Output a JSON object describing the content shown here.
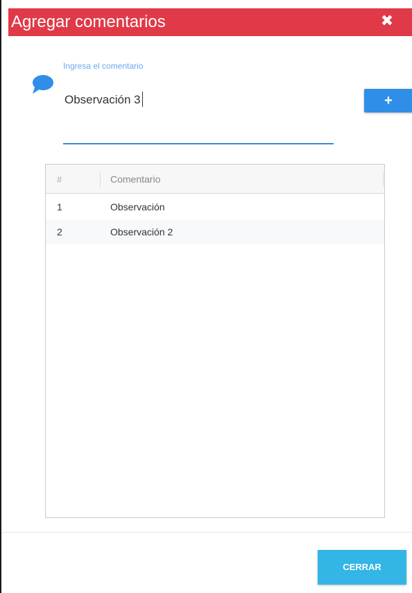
{
  "dialog": {
    "title": "Agregar comentarios",
    "close_icon": "close-icon",
    "accent_color": "#e03a48"
  },
  "form": {
    "label": "Ingresa el comentario",
    "value": "Observación 3",
    "add_label": "+",
    "chat_icon": "chat-bubble-icon"
  },
  "grid": {
    "columns": [
      "#",
      "Comentario"
    ],
    "rows": [
      {
        "num": "1",
        "text": "Observación"
      },
      {
        "num": "2",
        "text": "Observación 2"
      }
    ]
  },
  "footer": {
    "close_label": "CERRAR"
  }
}
